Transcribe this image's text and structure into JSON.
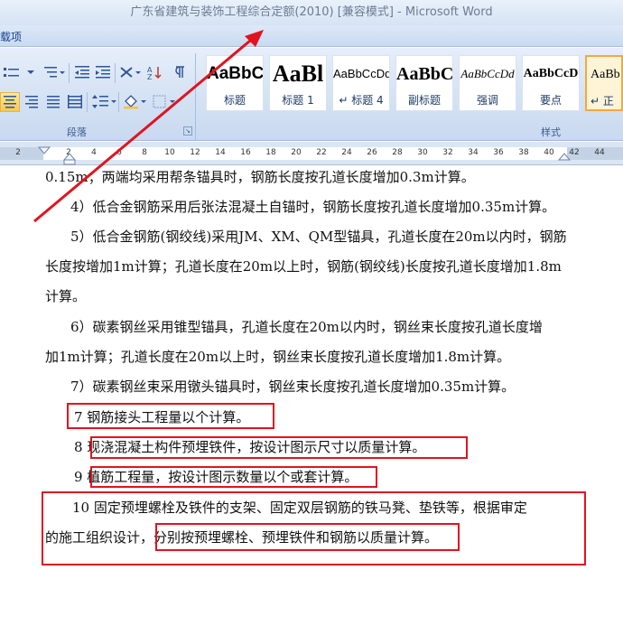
{
  "window": {
    "title": "广东省建筑与装饰工程综合定额(2010) [兼容模式] - Microsoft Word"
  },
  "ribbon": {
    "tab_partial": "载项",
    "paragraph_group_label": "段落",
    "styles_group_label": "样式",
    "styles": [
      {
        "sample": "AaBbC",
        "name": "标题"
      },
      {
        "sample": "AaBl",
        "name": "标题 1"
      },
      {
        "sample": "AaBbCcDd",
        "name": "↵ 标题 4"
      },
      {
        "sample": "AaBbC",
        "name": "副标题"
      },
      {
        "sample": "AaBbCcDd",
        "name": "强调"
      },
      {
        "sample": "AaBbCcD",
        "name": "要点"
      },
      {
        "sample": "AaBb",
        "name": "↵ 正"
      }
    ]
  },
  "ruler": {
    "ticks": [
      "2",
      "2",
      "4",
      "6",
      "8",
      "10",
      "12",
      "14",
      "16",
      "18",
      "20",
      "22",
      "24",
      "26",
      "28",
      "30",
      "32",
      "34",
      "36",
      "38",
      "40",
      "42",
      "44"
    ]
  },
  "document": {
    "lines": [
      "0.15m；两端均采用帮条锚具时，钢筋长度按孔道长度增加0.3m计算。",
      "4）低合金钢筋采用后张法混凝土自锚时，钢筋长度按孔道长度增加0.35m计算。",
      "5）低合金钢筋(钢绞线)采用JM、XM、QM型锚具，孔道长度在20m以内时，钢筋",
      "长度按增加1m计算；孔道长度在20m以上时，钢筋(钢绞线)长度按孔道长度增加1.8m",
      "计算。",
      "6）碳素钢丝采用锥型锚具，孔道长度在20m以内时，钢丝束长度按孔道长度增",
      "加1m计算；孔道长度在20m以上时，钢丝束长度按孔道长度增加1.8m计算。",
      "7）碳素钢丝束采用镦头锚具时，钢丝束长度按孔道长度增加0.35m计算。",
      "7  钢筋接头工程量以个计算。",
      "8  现浇混凝土构件预埋铁件，按设计图示尺寸以质量计算。",
      "9  植筋工程量，按设计图示数量以个或套计算。",
      "10  固定预埋螺栓及铁件的支架、固定双层钢筋的铁马凳、垫铁等，根据审定",
      "的施工组织设计，分别按预埋螺栓、预埋铁件和钢筋以质量计算。"
    ]
  },
  "colors": {
    "annotation_red": "#e0141f",
    "ribbon_blue": "#d3e1f3"
  }
}
